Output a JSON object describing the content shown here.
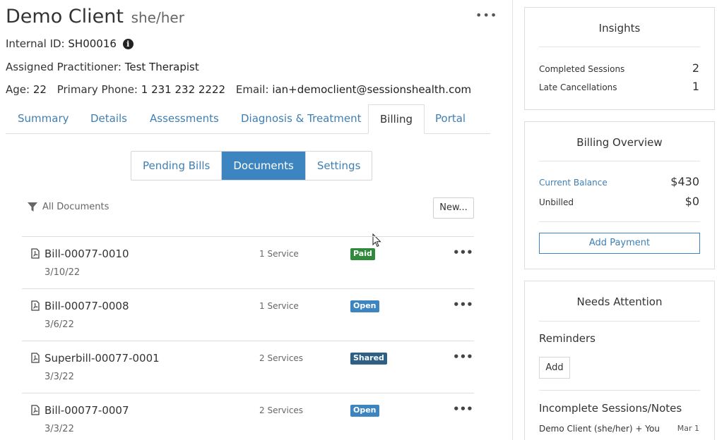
{
  "client": {
    "name": "Demo Client",
    "pronouns": "she/her",
    "internal_id_label": "Internal ID:",
    "internal_id": "SH00016",
    "practitioner_label": "Assigned Practitioner:",
    "practitioner": "Test Therapist",
    "age_label": "Age:",
    "age": "22",
    "phone_label": "Primary Phone:",
    "phone": "1 231 232 2222",
    "email_label": "Email:",
    "email": "ian+democlient@sessionshealth.com",
    "more_icon": "ellipsis-icon"
  },
  "tabs": [
    {
      "label": "Summary"
    },
    {
      "label": "Details"
    },
    {
      "label": "Assessments"
    },
    {
      "label": "Diagnosis & Treatment"
    },
    {
      "label": "Billing",
      "active": true
    },
    {
      "label": "Portal"
    }
  ],
  "subtabs": [
    {
      "label": "Pending Bills"
    },
    {
      "label": "Documents",
      "active": true
    },
    {
      "label": "Settings"
    }
  ],
  "filter": {
    "label": "All Documents",
    "icon": "filter-icon"
  },
  "new_button": "New...",
  "documents": [
    {
      "name": "Bill-00077-0010",
      "date": "3/10/22",
      "services": "1 Service",
      "status": "Paid",
      "status_color": "#2f8a3c"
    },
    {
      "name": "Bill-00077-0008",
      "date": "3/6/22",
      "services": "1 Service",
      "status": "Open",
      "status_color": "#3d85c0"
    },
    {
      "name": "Superbill-00077-0001",
      "date": "3/3/22",
      "services": "2 Services",
      "status": "Shared",
      "status_color": "#2e5f84"
    },
    {
      "name": "Bill-00077-0007",
      "date": "3/3/22",
      "services": "2 Services",
      "status": "Open",
      "status_color": "#3d85c0"
    }
  ],
  "insights": {
    "title": "Insights",
    "completed_label": "Completed Sessions",
    "completed_value": "2",
    "late_label": "Late Cancellations",
    "late_value": "1"
  },
  "billing_overview": {
    "title": "Billing Overview",
    "balance_label": "Current Balance",
    "balance_value": "$430",
    "unbilled_label": "Unbilled",
    "unbilled_value": "$0",
    "add_payment": "Add Payment"
  },
  "needs_attention": {
    "title": "Needs Attention",
    "reminders_title": "Reminders",
    "add_label": "Add",
    "incomplete_title": "Incomplete Sessions/Notes",
    "incomplete_item": "Demo Client (she/her) + You",
    "incomplete_date": "Mar 1"
  },
  "colors": {
    "accent": "#3d85c0",
    "link": "#3f7fb3"
  }
}
